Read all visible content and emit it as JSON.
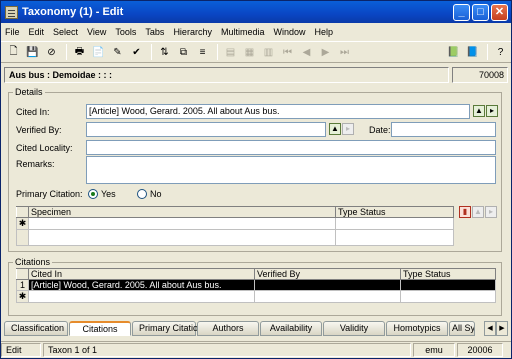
{
  "window": {
    "title": "Taxonomy (1) - Edit"
  },
  "menu": [
    "File",
    "Edit",
    "Select",
    "View",
    "Tools",
    "Tabs",
    "Hierarchy",
    "Multimedia",
    "Window",
    "Help"
  ],
  "record": {
    "title": "Aus bus : Demoidae : : :",
    "id": "70008"
  },
  "details": {
    "legend": "Details",
    "cited_in_label": "Cited In:",
    "cited_in_value": "[Article] Wood, Gerard. 2005. All about Aus bus.",
    "verified_by_label": "Verified By:",
    "verified_by_value": "",
    "date_label": "Date:",
    "date_value": "",
    "cited_locality_label": "Cited Locality:",
    "cited_locality_value": "",
    "remarks_label": "Remarks:",
    "remarks_value": "",
    "primary_citation_label": "Primary Citation:",
    "yes_label": "Yes",
    "no_label": "No",
    "primary_citation_selected": "Yes"
  },
  "specimen_grid": {
    "columns": [
      "Specimen",
      "Type Status"
    ],
    "new_row_marker": "✱"
  },
  "citations": {
    "legend": "Citations",
    "columns": [
      "Cited In",
      "Verified By",
      "Type Status"
    ],
    "rows": [
      {
        "num": "1",
        "cited_in": "[Article] Wood, Gerard. 2005. All about Aus bus.",
        "verified_by": "",
        "type_status": ""
      }
    ],
    "new_row_marker": "✱"
  },
  "tabs": [
    "Classification",
    "Citations",
    "Primary Citation",
    "Authors",
    "Availability",
    "Validity",
    "Homotypics",
    "All Sy"
  ],
  "active_tab": "Citations",
  "status": {
    "mode": "Edit",
    "position": "Taxon 1 of 1",
    "user": "emu",
    "number": "20006"
  },
  "colors": {
    "titlebar": "#0a46c4",
    "selected_row": "#000000",
    "active_tab_accent": "#e68b2c"
  }
}
